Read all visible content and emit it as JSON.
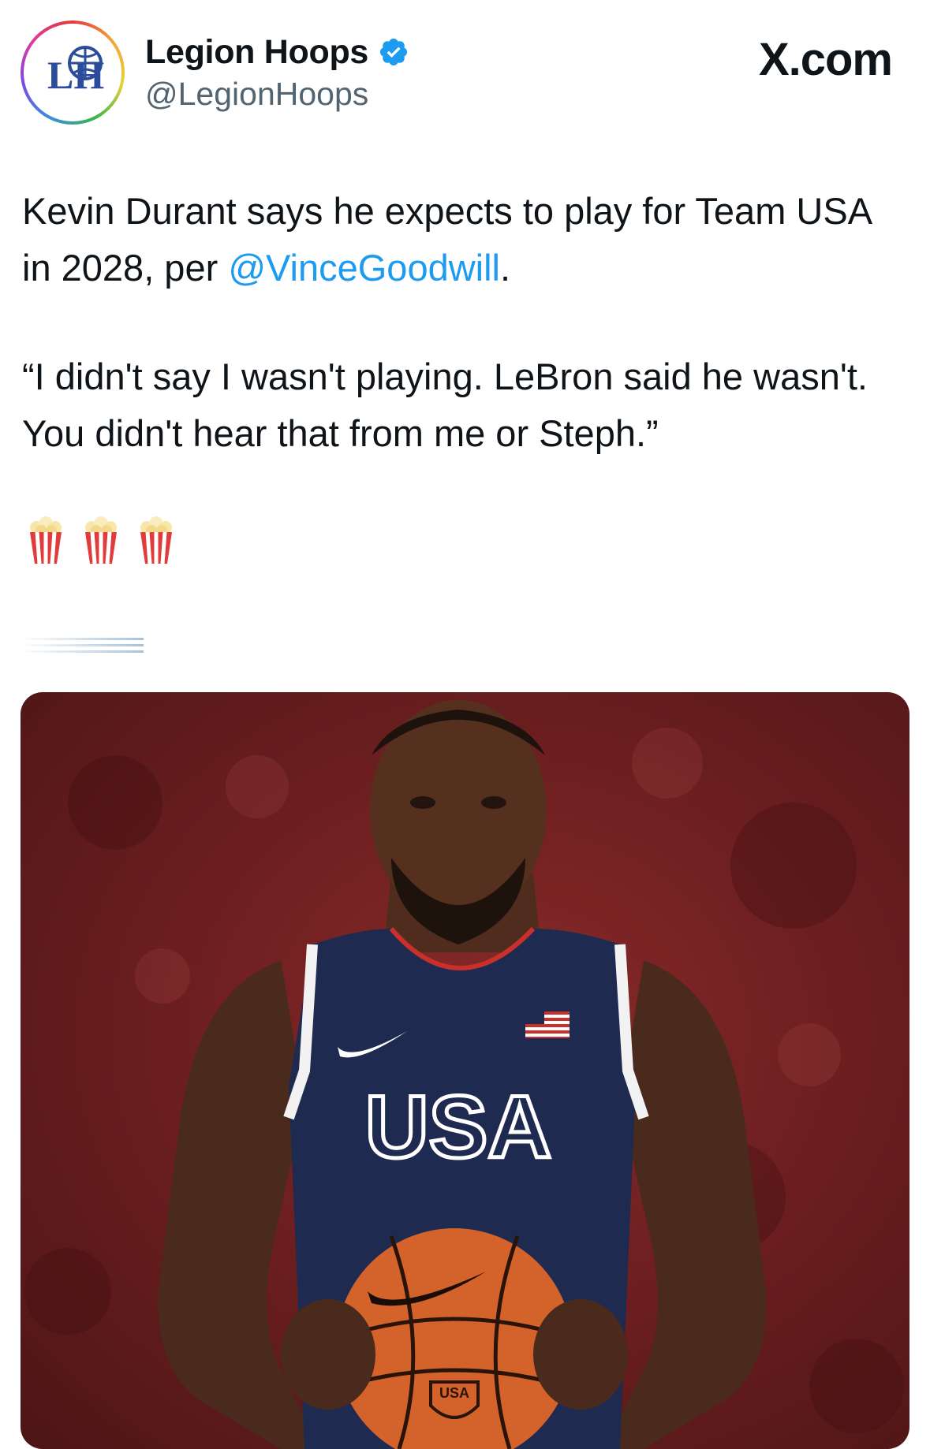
{
  "tweet": {
    "author": {
      "display_name": "Legion Hoops",
      "handle": "@LegionHoops",
      "verified": true,
      "avatar_text": "LH"
    },
    "brand": "X.com",
    "text": {
      "line1_before": "Kevin Durant says he expects to play for Team USA in 2028, per ",
      "mention": "@VinceGoodwill",
      "line1_after": ".",
      "quote": "“I didn't say I wasn't playing. LeBron said he wasn't. You didn't hear that from me or Steph.”"
    },
    "emoji": [
      "popcorn-icon",
      "popcorn-icon",
      "popcorn-icon"
    ],
    "media": {
      "jersey_text": "USA",
      "ball_logo_text": "USA"
    }
  },
  "colors": {
    "mention": "#1d9bf0",
    "verified": "#1d9bf0",
    "text": "#0f1419",
    "secondary": "#536471",
    "backdrop": "#6e1f20",
    "jersey": "#1e2a4f"
  }
}
